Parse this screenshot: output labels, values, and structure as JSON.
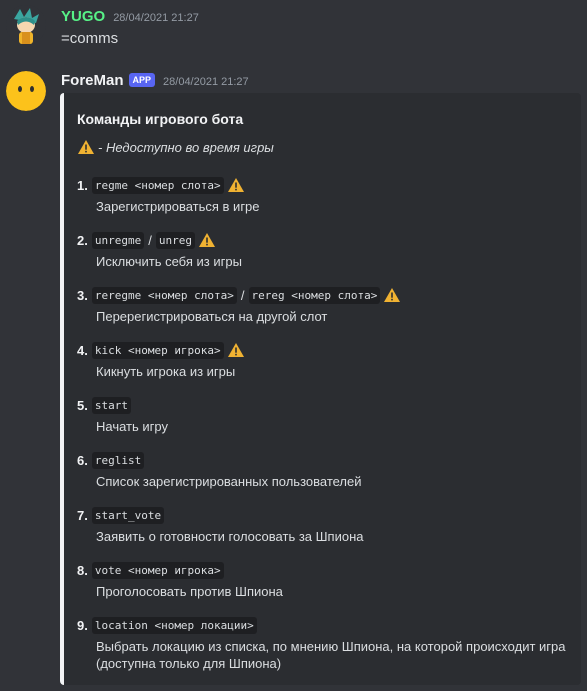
{
  "messages": [
    {
      "author": "YUGO",
      "author_color": "#57f287",
      "timestamp": "28/04/2021 21:27",
      "text": "=comms"
    },
    {
      "author": "ForeMan",
      "author_color": "#f2f3f5",
      "badge": "APP",
      "timestamp": "28/04/2021 21:27"
    }
  ],
  "embed": {
    "title": "Команды игрового бота",
    "note": "- Недоступно во время игры",
    "commands": [
      {
        "num": "1.",
        "code1": "regme <номер слота>",
        "warning": true,
        "desc": "Зарегистрироваться в игре"
      },
      {
        "num": "2.",
        "code1": "unregme",
        "sep": "/",
        "code2": "unreg",
        "warning": true,
        "desc": "Исключить себя из игры"
      },
      {
        "num": "3.",
        "code1": "reregme <номер слота>",
        "sep": "/",
        "code2": "rereg <номер слота>",
        "warning": true,
        "desc": "Перерегистрироваться на другой слот"
      },
      {
        "num": "4.",
        "code1": "kick <номер игрока>",
        "warning": true,
        "desc": "Кикнуть игрока из игры"
      },
      {
        "num": "5.",
        "code1": "start",
        "desc": "Начать игру"
      },
      {
        "num": "6.",
        "code1": "reglist",
        "desc": "Список зарегистрированных пользователей"
      },
      {
        "num": "7.",
        "code1": "start_vote",
        "desc": "Заявить о готовности голосовать за Шпиона"
      },
      {
        "num": "8.",
        "code1": "vote <номер игрока>",
        "desc": "Проголосовать против Шпиона"
      },
      {
        "num": "9.",
        "code1": "location <номер локации>",
        "desc": "Выбрать локацию из списка, по мнению Шпиона, на которой происходит игра (доступна только для Шпиона)"
      }
    ]
  }
}
